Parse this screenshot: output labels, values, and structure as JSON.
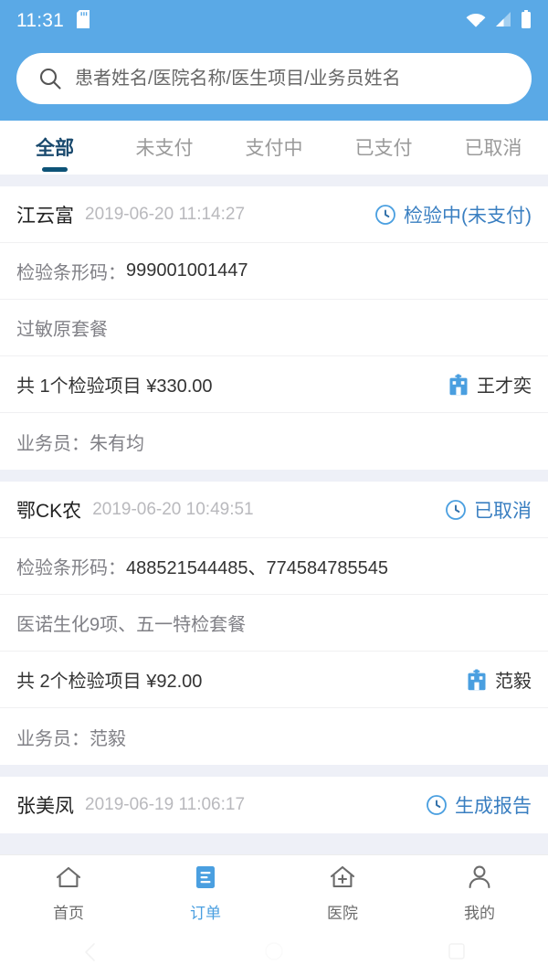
{
  "status_bar": {
    "time": "11:31",
    "icons": [
      "sd-card-icon",
      "wifi-off-icon",
      "cellular-signal-icon",
      "battery-full-icon"
    ]
  },
  "search": {
    "placeholder": "患者姓名/医院名称/医生项目/业务员姓名",
    "value": "",
    "icon": "search-icon"
  },
  "tabs": [
    {
      "label": "全部",
      "active": true
    },
    {
      "label": "未支付",
      "active": false
    },
    {
      "label": "支付中",
      "active": false
    },
    {
      "label": "已支付",
      "active": false
    },
    {
      "label": "已取消",
      "active": false
    }
  ],
  "orders": [
    {
      "patient": "江云富",
      "time": "2019-06-20 11:14:27",
      "status": "检验中(未支付)",
      "status_icon": "clock-icon",
      "barcode_label": "检验条形码：",
      "barcode_value": "999001001447",
      "items": "过敏原套餐",
      "summary": "共 1个检验项目 ¥330.00",
      "doctor": "王才奕",
      "doctor_icon": "hospital-icon",
      "salesman": "业务员：朱有均"
    },
    {
      "patient": "鄂CK农",
      "time": "2019-06-20 10:49:51",
      "status": "已取消",
      "status_icon": "clock-icon",
      "barcode_label": "检验条形码：",
      "barcode_value": "488521544485、774584785545",
      "items": "医诺生化9项、五一特检套餐",
      "summary": "共 2个检验项目 ¥92.00",
      "doctor": "范毅",
      "doctor_icon": "hospital-icon",
      "salesman": "业务员：范毅"
    },
    {
      "patient": "张美凤",
      "time": "2019-06-19 11:06:17",
      "status": "生成报告",
      "status_icon": "clock-icon"
    }
  ],
  "bottom_nav": [
    {
      "label": "首页",
      "icon": "home-icon",
      "active": false
    },
    {
      "label": "订单",
      "icon": "order-list-icon",
      "active": true
    },
    {
      "label": "医院",
      "icon": "hospital-icon",
      "active": false
    },
    {
      "label": "我的",
      "icon": "person-icon",
      "active": false
    }
  ],
  "android_nav": [
    "back-icon",
    "home-icon",
    "recents-icon"
  ],
  "colors": {
    "header_blue": "#5aa9e6",
    "accent_blue": "#4a9fe0",
    "status_blue": "#3a7fc1",
    "tab_active": "#1a4a6e",
    "band_gray": "#eef0f7"
  }
}
